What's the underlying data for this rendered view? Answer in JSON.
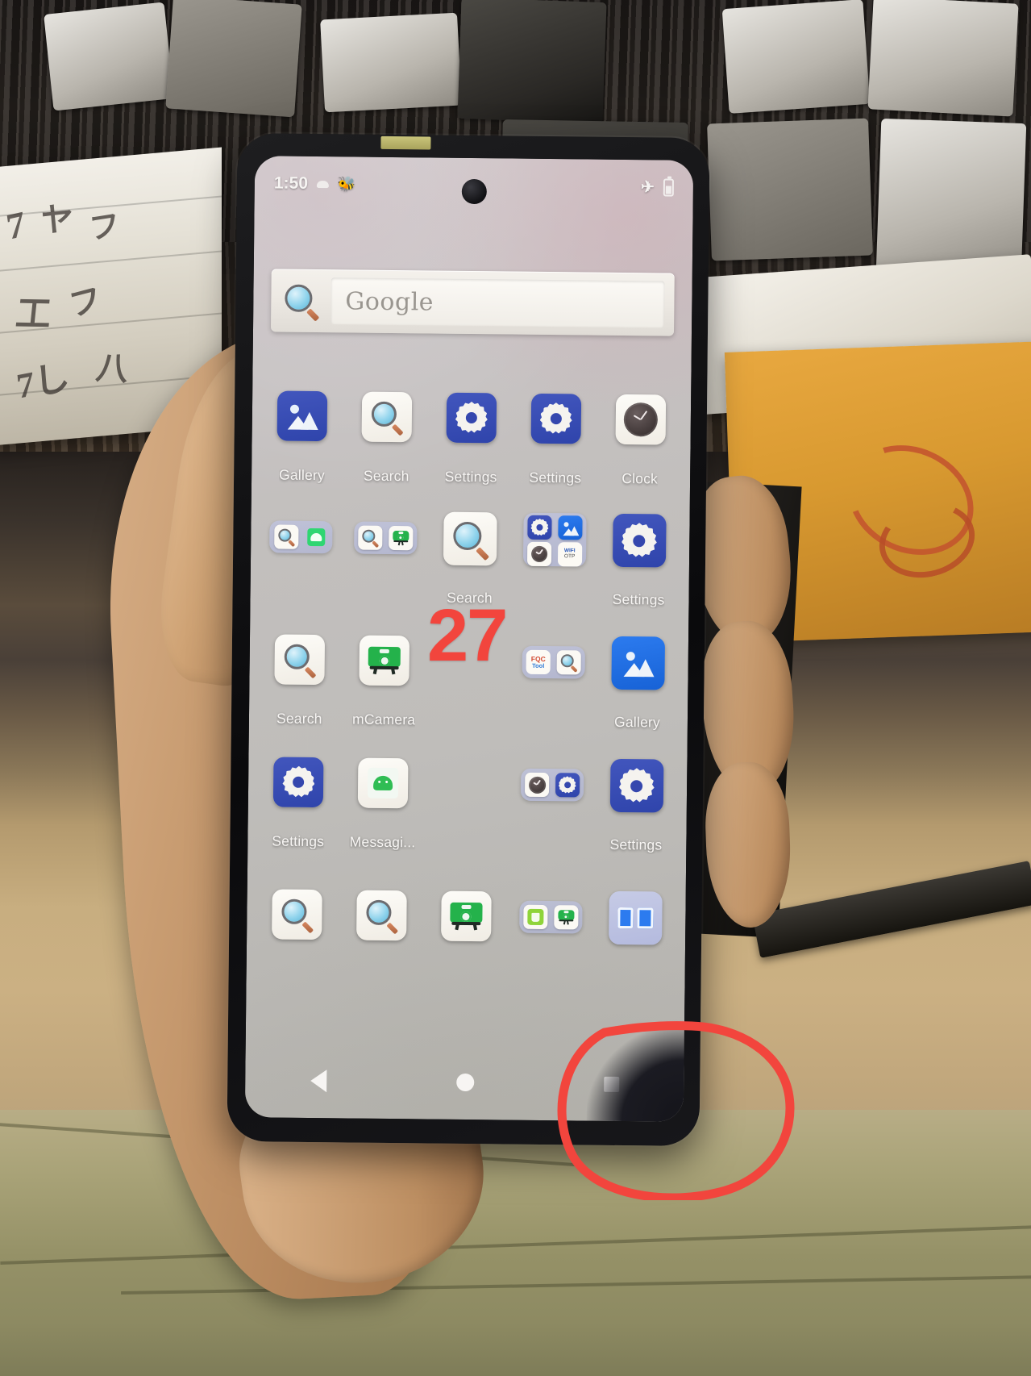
{
  "scene": {
    "description": "photo-of-phone-on-repair-bench",
    "annotation_number": "27",
    "annotation_color": "#f2453d",
    "circle_annotation_color": "#f2453d"
  },
  "phone": {
    "status_bar": {
      "time": "1:50",
      "left_icons": [
        "cloud-icon",
        "bug-icon"
      ],
      "right_icons": [
        "airplane-mode-icon",
        "battery-icon"
      ]
    },
    "search_widget": {
      "icon": "magnifier-icon",
      "placeholder": "Google"
    },
    "rows": [
      {
        "cells": [
          {
            "type": "app",
            "icon": "gallery-icon",
            "label": "Gallery"
          },
          {
            "type": "app",
            "icon": "search-icon",
            "label": "Search"
          },
          {
            "type": "app",
            "icon": "settings-icon",
            "label": "Settings"
          },
          {
            "type": "app",
            "icon": "settings-icon",
            "label": "Settings"
          },
          {
            "type": "app",
            "icon": "clock-icon",
            "label": "Clock"
          }
        ]
      },
      {
        "cells": [
          {
            "type": "folder",
            "icons": [
              "search-icon",
              "messaging-icon"
            ],
            "label": ""
          },
          {
            "type": "folder",
            "icons": [
              "search-icon",
              "camera-icon"
            ],
            "label": ""
          },
          {
            "type": "app",
            "icon": "search-icon",
            "label": "Search"
          },
          {
            "type": "folder",
            "icons": [
              "settings-icon",
              "gallery-icon",
              "clock-icon",
              "wifi-otp-icon"
            ],
            "label": ""
          },
          {
            "type": "app",
            "icon": "settings-icon",
            "label": "Settings"
          }
        ]
      },
      {
        "cells": [
          {
            "type": "app",
            "icon": "search-icon",
            "label": "Search"
          },
          {
            "type": "app",
            "icon": "camera-icon",
            "label": "mCamera"
          },
          {
            "type": "blank",
            "icon": "",
            "label": ""
          },
          {
            "type": "folder",
            "icons": [
              "fqc-tool-icon",
              "search-icon"
            ],
            "label": ""
          },
          {
            "type": "app",
            "icon": "gallery-icon",
            "label": "Gallery"
          }
        ]
      },
      {
        "cells": [
          {
            "type": "app",
            "icon": "settings-icon",
            "label": "Settings"
          },
          {
            "type": "app",
            "icon": "messaging-icon",
            "label": "Messagi..."
          },
          {
            "type": "blank",
            "icon": "",
            "label": ""
          },
          {
            "type": "folder",
            "icons": [
              "clock-icon",
              "settings-icon"
            ],
            "label": ""
          },
          {
            "type": "app",
            "icon": "settings-icon",
            "label": "Settings"
          }
        ]
      },
      {
        "cells": [
          {
            "type": "app",
            "icon": "search-icon",
            "label": ""
          },
          {
            "type": "app",
            "icon": "search-icon",
            "label": ""
          },
          {
            "type": "app",
            "icon": "camera-icon",
            "label": ""
          },
          {
            "type": "folder",
            "icons": [
              "trash-icon",
              "camera-icon"
            ],
            "label": ""
          },
          {
            "type": "app",
            "icon": "two-window-icon",
            "label": ""
          }
        ]
      }
    ],
    "nav_bar": {
      "back": "back-icon",
      "home": "home-icon",
      "recents": "recents-icon"
    }
  },
  "fqc": {
    "line1": "FQC",
    "line2": "Tool"
  },
  "wifiotp": {
    "line1": "WIFI",
    "line2": "OTP"
  }
}
